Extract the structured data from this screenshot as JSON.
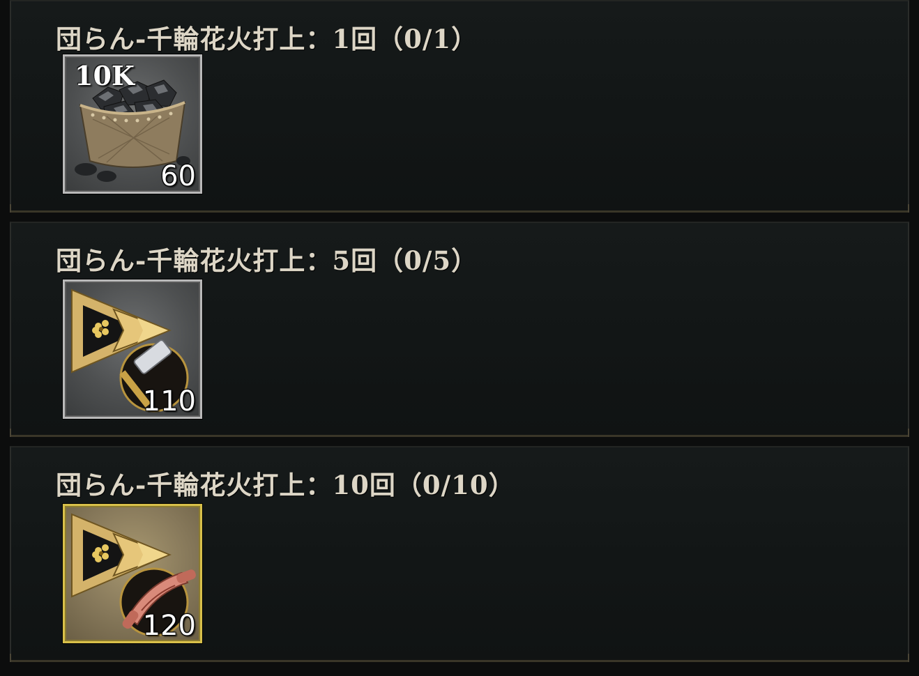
{
  "missions": [
    {
      "title": "団らん-千輪花火打上：1回（0/1）",
      "reward": {
        "icon": "coal-basket-icon",
        "badge": "10K",
        "quantity": "60"
      }
    },
    {
      "title": "団らん-千輪花火打上：5回（0/5）",
      "reward": {
        "icon": "hammer-speedup-icon",
        "quantity": "110"
      }
    },
    {
      "title": "団らん-千輪花火打上：10回（0/10）",
      "reward": {
        "icon": "scroll-speedup-icon",
        "quantity": "120"
      }
    }
  ],
  "colors": {
    "panel_bg": "#141818",
    "title_text": "#ddd6c6",
    "gold_frame": "#d8c04a",
    "silver_frame": "#b9b9b9"
  }
}
